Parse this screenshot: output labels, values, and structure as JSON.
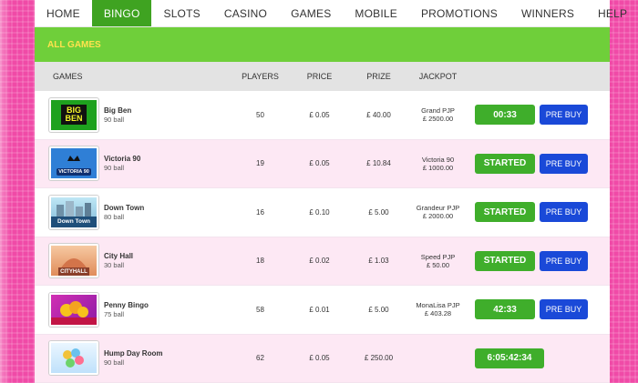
{
  "nav": {
    "items": [
      "HOME",
      "BINGO",
      "SLOTS",
      "CASINO",
      "GAMES",
      "MOBILE",
      "PROMOTIONS",
      "WINNERS",
      "HELP"
    ],
    "active_index": 1
  },
  "section": {
    "title": "ALL GAMES"
  },
  "table": {
    "headers": {
      "games": "GAMES",
      "players": "PLAYERS",
      "price": "PRICE",
      "prize": "PRIZE",
      "jackpot": "JACKPOT"
    },
    "rows": [
      {
        "name": "Big Ben",
        "type": "90 ball",
        "thumb_text_1": "BIG",
        "thumb_text_2": "BEN",
        "players": "50",
        "price": "£ 0.05",
        "prize": "£ 40.00",
        "jackpot_1": "Grand PJP",
        "jackpot_2": "£ 2500.00",
        "status": "00:33",
        "prebuy": "PRE BUY"
      },
      {
        "name": "Victoria 90",
        "type": "90 ball",
        "thumb_text_1": "VICTORIA 90",
        "players": "19",
        "price": "£ 0.05",
        "prize": "£ 10.84",
        "jackpot_1": "Victoria 90",
        "jackpot_2": "£ 1000.00",
        "status": "STARTED",
        "prebuy": "PRE BUY"
      },
      {
        "name": "Down Town",
        "type": "80 ball",
        "thumb_text_1": "Down Town",
        "players": "16",
        "price": "£ 0.10",
        "prize": "£ 5.00",
        "jackpot_1": "Grandeur PJP",
        "jackpot_2": "£ 2000.00",
        "status": "STARTED",
        "prebuy": "PRE BUY"
      },
      {
        "name": "City Hall",
        "type": "30 ball",
        "thumb_text_1": "CITYHALL",
        "players": "18",
        "price": "£ 0.02",
        "prize": "£ 1.03",
        "jackpot_1": "Speed PJP",
        "jackpot_2": "£ 50.00",
        "status": "STARTED",
        "prebuy": "PRE BUY"
      },
      {
        "name": "Penny Bingo",
        "type": "75 ball",
        "thumb_text_1": "",
        "players": "58",
        "price": "£ 0.01",
        "prize": "£ 5.00",
        "jackpot_1": "MonaLisa PJP",
        "jackpot_2": "£ 403.28",
        "status": "42:33",
        "prebuy": "PRE BUY"
      },
      {
        "name": "Hump Day Room",
        "type": "90 ball",
        "thumb_text_1": "",
        "players": "62",
        "price": "£ 0.05",
        "prize": "£ 250.00",
        "jackpot_1": "",
        "jackpot_2": "",
        "status": "6:05:42:34"
      }
    ]
  },
  "colors": {
    "nav_active": "#3fa321",
    "band": "#6fcf3a",
    "band_text": "#ffe24d",
    "button_green": "#3fae2b",
    "button_blue": "#1a49d8",
    "row_alt": "#fde8f4",
    "page_background": "#f04aa7"
  },
  "icons": [
    "big-ben-thumbnail",
    "victoria-90-thumbnail",
    "down-town-thumbnail",
    "city-hall-thumbnail",
    "penny-bingo-thumbnail",
    "hump-day-room-thumbnail"
  ]
}
